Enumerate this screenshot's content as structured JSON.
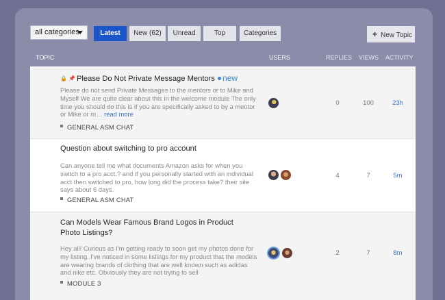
{
  "nav": {
    "category_select": "all categories",
    "tabs": [
      "Latest",
      "New (62)",
      "Unread",
      "Top",
      "Categories"
    ],
    "active_tab": "Latest",
    "new_topic_label": "New Topic"
  },
  "columns": {
    "topic": "TOPIC",
    "users": "USERS",
    "replies": "REPLIES",
    "views": "VIEWS",
    "activity": "ACTIVITY"
  },
  "topics": [
    {
      "title": "Please Do Not Private Message Mentors",
      "badge": "new",
      "excerpt": "Please do not send Private Messages to the mentors or to Mike and Myself We are quite clear about this in the welcome module The only time you should do this is if you are specifically asked to by a mentor or Mike or m…",
      "read_more": "read more",
      "category": "GENERAL ASM CHAT",
      "replies": "0",
      "views": "100",
      "activity": "23h"
    },
    {
      "title": "Question about switching to pro account",
      "excerpt": "Can anyone tell me what documents Amazon asks for when you switch to a pro acct.? and if you personally started with an individual acct then switched to pro, how long did the process take? their site says about 6 days.",
      "category": "GENERAL ASM CHAT",
      "replies": "4",
      "views": "7",
      "activity": "5m"
    },
    {
      "title": "Can Models Wear Famous Brand Logos in Product Photo Listings?",
      "excerpt": "Hey all! Curious as I'm getting ready to soon get my photos done for my listing. I've noticed in some listings for my product that the models are wearing brands of clothing that are well known such as adidas and nike etc. Obviously they are not trying to sell",
      "category": "MODULE 3",
      "replies": "2",
      "views": "7",
      "activity": "8m"
    }
  ]
}
